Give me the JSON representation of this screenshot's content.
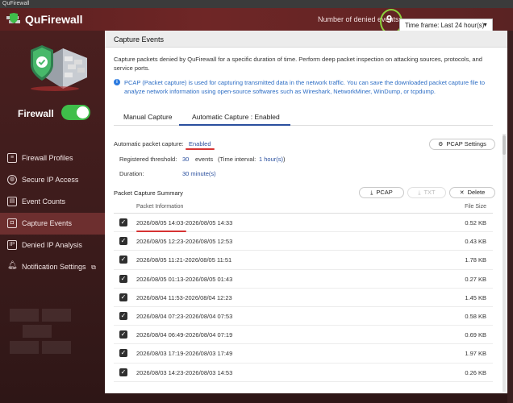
{
  "window": {
    "title": "QuFirewall"
  },
  "header": {
    "app_name": "QuFirewall",
    "denied_label": "Number of denied events:",
    "denied_count": "9",
    "timeframe": "Time frame: Last 24 hour(s)"
  },
  "sidebar": {
    "firewall_label": "Firewall",
    "firewall_enabled": true,
    "items": [
      {
        "label": "Firewall Profiles",
        "icon": "list-icon"
      },
      {
        "label": "Secure IP Access",
        "icon": "globe-icon"
      },
      {
        "label": "Event Counts",
        "icon": "document-icon"
      },
      {
        "label": "Capture Events",
        "icon": "capture-icon",
        "active": true
      },
      {
        "label": "Denied IP Analysis",
        "icon": "ip-icon"
      },
      {
        "label": "Notification Settings",
        "icon": "bell-icon"
      }
    ]
  },
  "main": {
    "title": "Capture Events",
    "description": "Capture packets denied by QuFirewall for a specific duration of time. Perform deep packet inspection on attacking sources, protocols, and service ports.",
    "pcap_note": "PCAP (Packet capture) is used for capturing transmitted data in the network traffic. You can save the downloaded packet capture file to analyze network information using open-source softwares such as Wireshark, NetworkMiner, WinDump, or tcpdump.",
    "tabs": [
      {
        "label": "Manual Capture"
      },
      {
        "label": "Automatic Capture : Enabled",
        "active": true
      }
    ],
    "auto_capture_label": "Automatic packet capture:",
    "auto_capture_value": "Enabled",
    "pcap_settings_btn": "PCAP Settings",
    "threshold_label": "Registered threshold:",
    "threshold_value": "30",
    "threshold_events": "events",
    "time_interval_label": "(Time interval:",
    "time_interval_value": "1 hour(s)",
    "time_interval_close": ")",
    "duration_label": "Duration:",
    "duration_value": "30 minute(s)",
    "summary_title": "Packet Capture Summary",
    "buttons": {
      "pcap": "PCAP",
      "txt": "TXT",
      "delete": "Delete"
    },
    "table": {
      "headers": {
        "info": "Packet Information",
        "size": "File Size"
      },
      "rows": [
        {
          "info": "2026/08/05 14:03-2026/08/05 14:33",
          "size": "0.52 KB",
          "checked": true
        },
        {
          "info": "2026/08/05 12:23-2026/08/05 12:53",
          "size": "0.43 KB",
          "checked": true
        },
        {
          "info": "2026/08/05 11:21-2026/08/05 11:51",
          "size": "1.78 KB",
          "checked": true
        },
        {
          "info": "2026/08/05 01:13-2026/08/05 01:43",
          "size": "0.27 KB",
          "checked": true
        },
        {
          "info": "2026/08/04 11:53-2026/08/04 12:23",
          "size": "1.45 KB",
          "checked": true
        },
        {
          "info": "2026/08/04 07:23-2026/08/04 07:53",
          "size": "0.58 KB",
          "checked": true
        },
        {
          "info": "2026/08/04 06:49-2026/08/04 07:19",
          "size": "0.69 KB",
          "checked": true
        },
        {
          "info": "2026/08/03 17:19-2026/08/03 17:49",
          "size": "1.97 KB",
          "checked": true
        },
        {
          "info": "2026/08/03 14:23-2026/08/03 14:53",
          "size": "0.26 KB",
          "checked": true
        }
      ]
    }
  },
  "colors": {
    "accent": "#2a4f9e",
    "header_bg": "#6f2626",
    "toggle_on": "#3fbe4a",
    "annotation_red": "#d63333",
    "annotation_green": "#8bd23c"
  }
}
